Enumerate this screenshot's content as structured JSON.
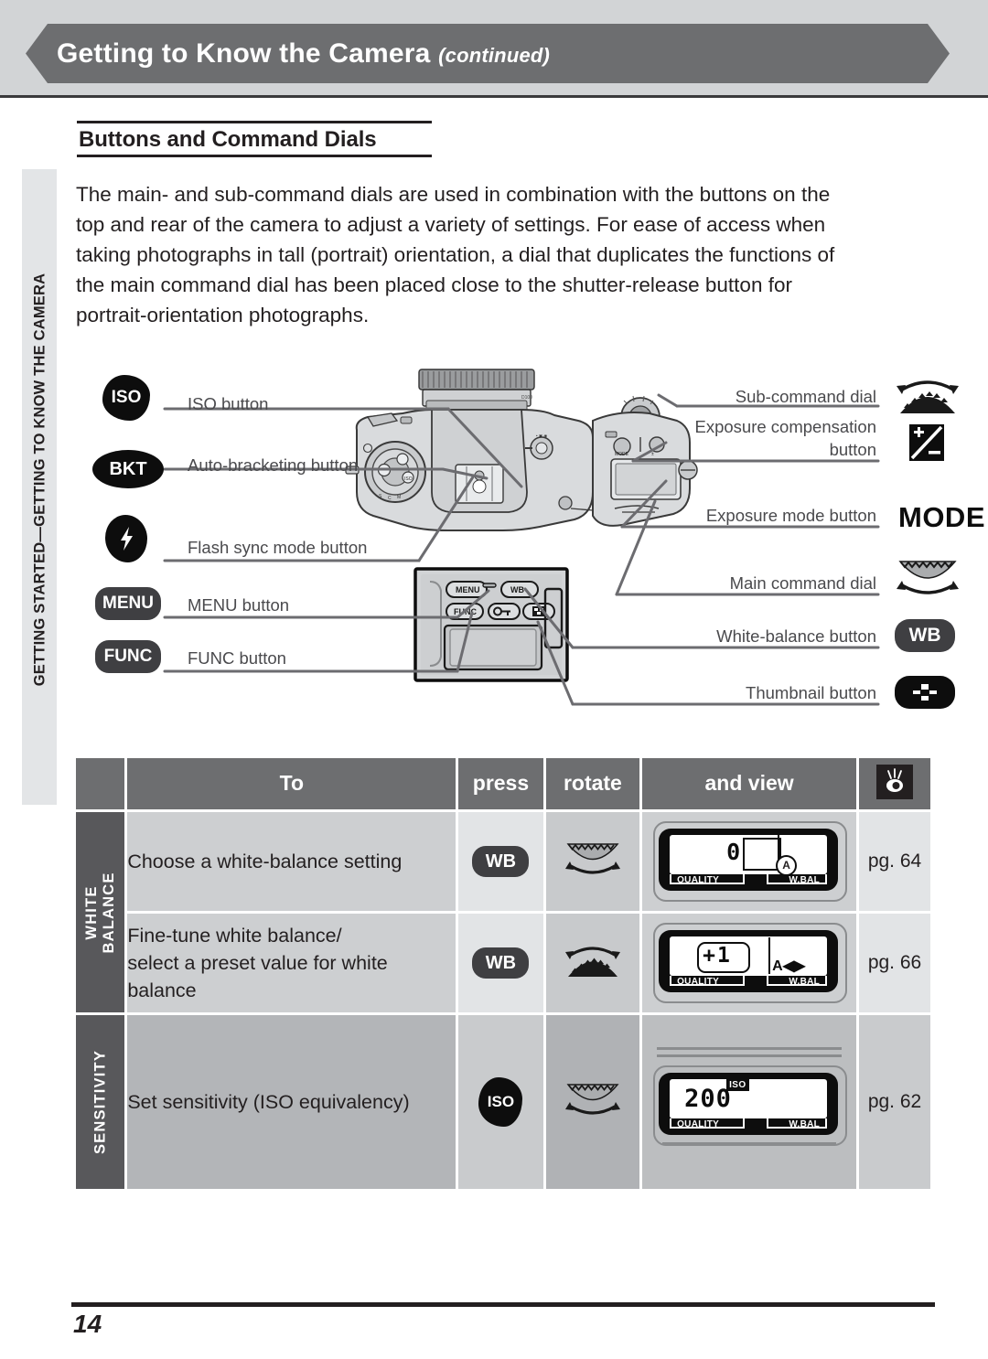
{
  "header": {
    "title": "Getting to Know the Camera",
    "continued": "(continued)"
  },
  "side_tab": {
    "label": "GETTING STARTED—GETTING TO KNOW THE CAMERA"
  },
  "section": {
    "title": "Buttons and Command Dials",
    "paragraph_lines": [
      "The main- and sub-command dials are used in combination with the buttons on the",
      "top and rear of the camera to adjust a variety of settings.  For ease of access when",
      "taking photographs in tall (portrait) orientation, a dial that duplicates the functions of",
      "the main command dial has been placed close to the shutter-release button for",
      "portrait-orientation photographs."
    ]
  },
  "diagram": {
    "left_callouts": [
      {
        "badge": "ISO",
        "icon": "iso-badge-icon",
        "label": "ISO button"
      },
      {
        "badge": "BKT",
        "icon": "bracketing-badge-icon",
        "label": "Auto-bracketing button"
      },
      {
        "badge": "⚡",
        "icon": "flash-badge-icon",
        "label": "Flash sync mode button"
      },
      {
        "badge": "MENU",
        "icon": "menu-badge-icon",
        "label": "MENU button"
      },
      {
        "badge": "FUNC",
        "icon": "func-badge-icon",
        "label": "FUNC button"
      }
    ],
    "right_callouts": [
      {
        "label": "Sub-command dial",
        "icon": "sub-command-dial-icon",
        "glyph": ""
      },
      {
        "label": "Exposure compensation",
        "label2": "button",
        "icon": "exposure-compensation-icon",
        "glyph": "±"
      },
      {
        "label": "Exposure mode button",
        "icon": "mode-text-icon",
        "glyph": "MODE"
      },
      {
        "label": "Main command dial",
        "icon": "main-command-dial-icon",
        "glyph": ""
      },
      {
        "label": "White-balance button",
        "icon": "wb-badge-icon",
        "glyph": "WB"
      },
      {
        "label": "Thumbnail button",
        "icon": "thumbnail-badge-icon",
        "glyph": ""
      }
    ],
    "camera_labels": {
      "top_view": "camera-top-view",
      "rear_view": "camera-rear-view",
      "rear_buttons": [
        "MENU",
        "WB",
        "FUNC",
        "lock",
        "thumbnail"
      ]
    }
  },
  "table": {
    "headers": {
      "category": "",
      "to": "To",
      "press": "press",
      "rotate": "rotate",
      "view": "and view",
      "page": "eye-icon"
    },
    "groups": [
      {
        "name": "WHITE BALANCE",
        "name_lines": [
          "WHITE",
          "BALANCE"
        ],
        "rows": [
          {
            "to_lines": [
              "Choose a white-balance setting"
            ],
            "press": "WB",
            "press_kind": "wb",
            "rotate": "main-command-dial-icon",
            "lcd": {
              "value": "0",
              "indicator": "A",
              "quality_label": "QUALITY",
              "wbal_label": "W.BAL"
            },
            "page": "pg. 64"
          },
          {
            "to_lines": [
              "Fine-tune white balance/",
              "select a preset value for white",
              "balance"
            ],
            "press": "WB",
            "press_kind": "wb",
            "rotate": "sub-command-dial-icon",
            "lcd": {
              "value": "+1",
              "indicator": "A◀▶",
              "quality_label": "QUALITY",
              "wbal_label": "W.BAL"
            },
            "page": "pg. 66"
          }
        ]
      },
      {
        "name": "SENSITIVITY",
        "name_lines": [
          "SENSITIVITY"
        ],
        "rows": [
          {
            "to_lines": [
              "Set sensitivity (ISO equivalency)"
            ],
            "press": "ISO",
            "press_kind": "iso",
            "rotate": "main-command-dial-icon",
            "lcd": {
              "value": "200",
              "indicator": "ISO",
              "quality_label": "QUALITY",
              "wbal_label": "W.BAL"
            },
            "page": "pg. 62"
          }
        ]
      }
    ]
  },
  "footer": {
    "page_number": "14"
  },
  "colors": {
    "banner": "#6d6e70",
    "banner_bg": "#d2d4d6",
    "table_header": "#6d6e70",
    "category_cell": "#58585b",
    "ink": "#231f20"
  }
}
